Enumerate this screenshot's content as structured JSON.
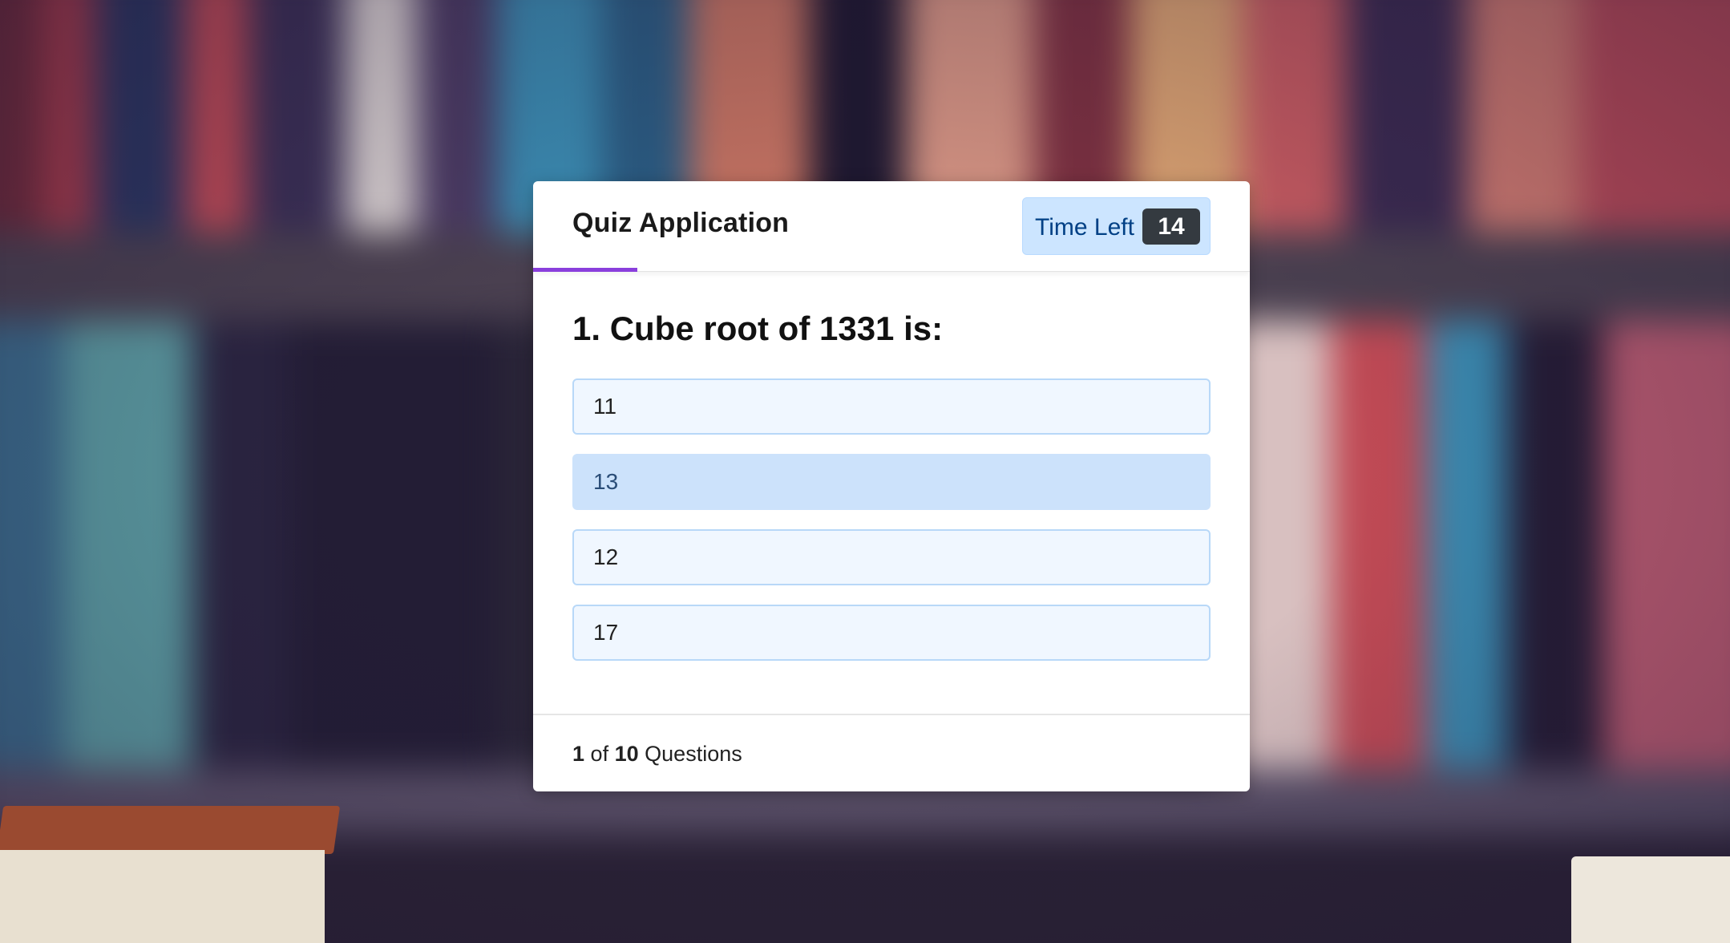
{
  "header": {
    "title": "Quiz Application",
    "timer_label": "Time Left",
    "timer_value": "14"
  },
  "question": {
    "text": "1. Cube root of 1331 is:",
    "options": [
      "11",
      "13",
      "12",
      "17"
    ],
    "hovered_option_index": 1
  },
  "footer": {
    "current": "1",
    "of_word": "of",
    "total": "10",
    "suffix": "Questions"
  },
  "colors": {
    "accent_progress": "#8a3fdc",
    "timer_bg": "#cce5ff",
    "timer_badge": "#343a40",
    "option_bg": "#f0f7ff",
    "option_border": "#b8d8f8",
    "option_hover_bg": "#cce2fb"
  },
  "progress": {
    "fraction": 0.1
  }
}
